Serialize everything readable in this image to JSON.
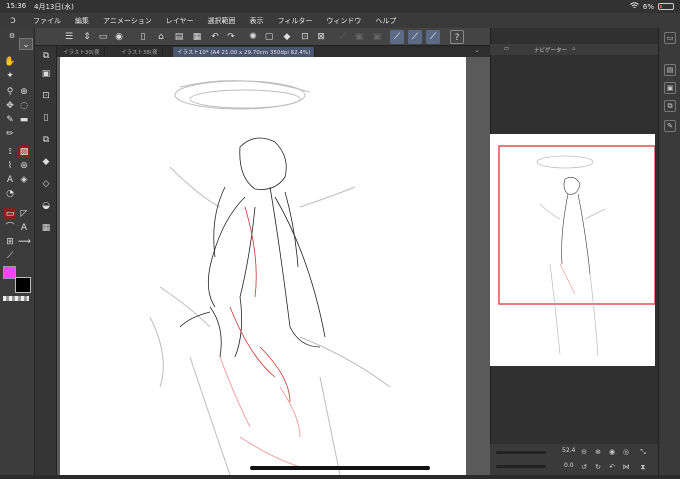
{
  "status": {
    "time": "15:36",
    "date": "4月13日(水)",
    "battery": "6%",
    "wifi_icon": "wifi-icon"
  },
  "menu": {
    "logo_icon": "clip-studio-logo-icon",
    "items": [
      "ファイル",
      "編集",
      "アニメーション",
      "レイヤー",
      "選択範囲",
      "表示",
      "フィルター",
      "ウィンドウ",
      "ヘルプ"
    ]
  },
  "tabs": [
    {
      "label": "イラスト30(夜",
      "active": false
    },
    {
      "label": "イラスト38(夜",
      "active": false
    },
    {
      "label": "イラスト10* (A4 21.00 x 29.70cm 350dpi 62.4%)",
      "active": true
    }
  ],
  "navigator": {
    "title": "ナビゲーター",
    "zoom": "52.4",
    "rotation": "0.0"
  },
  "colors": {
    "main": "#ff44ff",
    "sub": "#000000",
    "accent": "#5c6a86",
    "active_tool": "#8a1f1f",
    "nav_frame": "#e05050"
  }
}
